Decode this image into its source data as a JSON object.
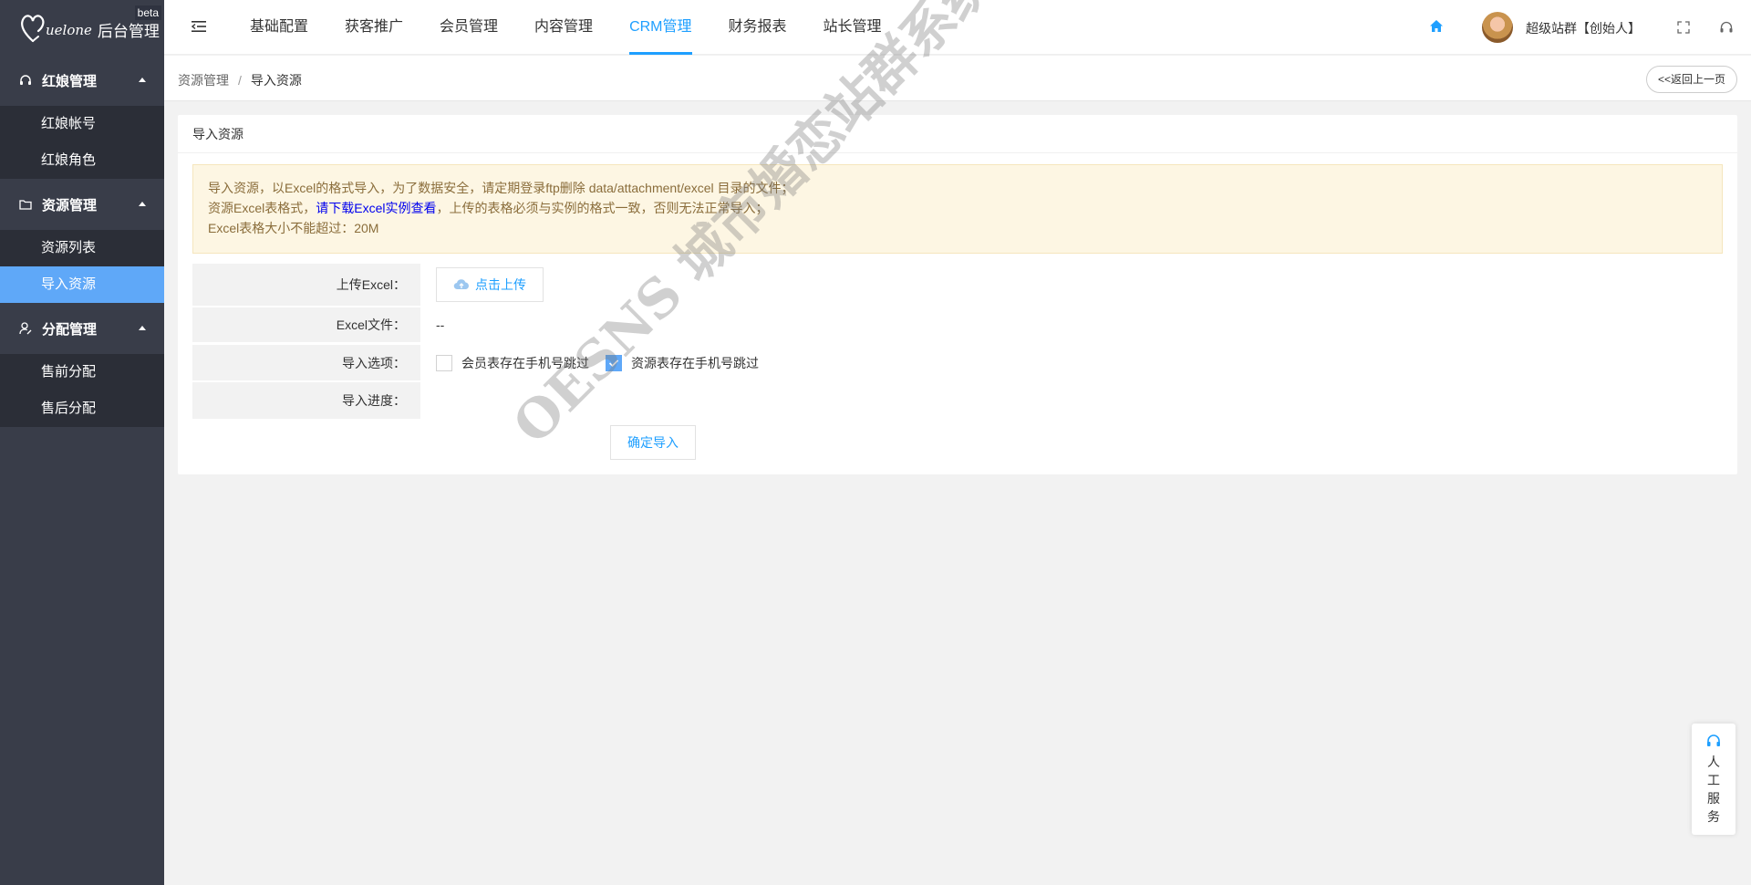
{
  "app": {
    "logo_script": "uelone",
    "title": "后台管理",
    "beta": "beta"
  },
  "sidebar": {
    "groups": [
      {
        "label": "红娘管理",
        "icon": "headset-icon",
        "items": [
          {
            "label": "红娘帐号"
          },
          {
            "label": "红娘角色"
          }
        ]
      },
      {
        "label": "资源管理",
        "icon": "folder-icon",
        "items": [
          {
            "label": "资源列表"
          },
          {
            "label": "导入资源",
            "active": true
          }
        ]
      },
      {
        "label": "分配管理",
        "icon": "user-edit-icon",
        "items": [
          {
            "label": "售前分配"
          },
          {
            "label": "售后分配"
          }
        ]
      }
    ]
  },
  "header": {
    "tabs": [
      {
        "label": "基础配置"
      },
      {
        "label": "获客推广"
      },
      {
        "label": "会员管理"
      },
      {
        "label": "内容管理"
      },
      {
        "label": "CRM管理",
        "active": true
      },
      {
        "label": "财务报表"
      },
      {
        "label": "站长管理"
      }
    ],
    "username": "超级站群【创始人】"
  },
  "breadcrumb": {
    "parent": "资源管理",
    "separator": "/",
    "current": "导入资源",
    "back_label": "<<返回上一页"
  },
  "card": {
    "title": "导入资源",
    "notice": {
      "line1": "导入资源，以Excel的格式导入，为了数据安全，请定期登录ftp删除 data/attachment/excel 目录的文件；",
      "line2_prefix": "资源Excel表格式，",
      "line2_link": "请下载Excel实例查看",
      "line2_suffix": "，上传的表格必须与实例的格式一致，否则无法正常导入；",
      "line3": "Excel表格大小不能超过：20M"
    },
    "form": {
      "upload_label": "上传Excel：",
      "upload_button": "点击上传",
      "file_label": "Excel文件：",
      "file_value": "--",
      "options_label": "导入选项：",
      "option1": "会员表存在手机号跳过",
      "option1_checked": false,
      "option2": "资源表存在手机号跳过",
      "option2_checked": true,
      "progress_label": "导入进度：",
      "submit_button": "确定导入"
    }
  },
  "watermark": "OESNS 城市婚恋站群系统",
  "service": {
    "label": "人工服务"
  },
  "colors": {
    "sidebar_bg": "#393d49",
    "sidebar_sub_bg": "#2b2e37",
    "active_item": "#5fa8f8",
    "accent": "#1e9fff",
    "notice_bg": "#fdf6e3"
  }
}
